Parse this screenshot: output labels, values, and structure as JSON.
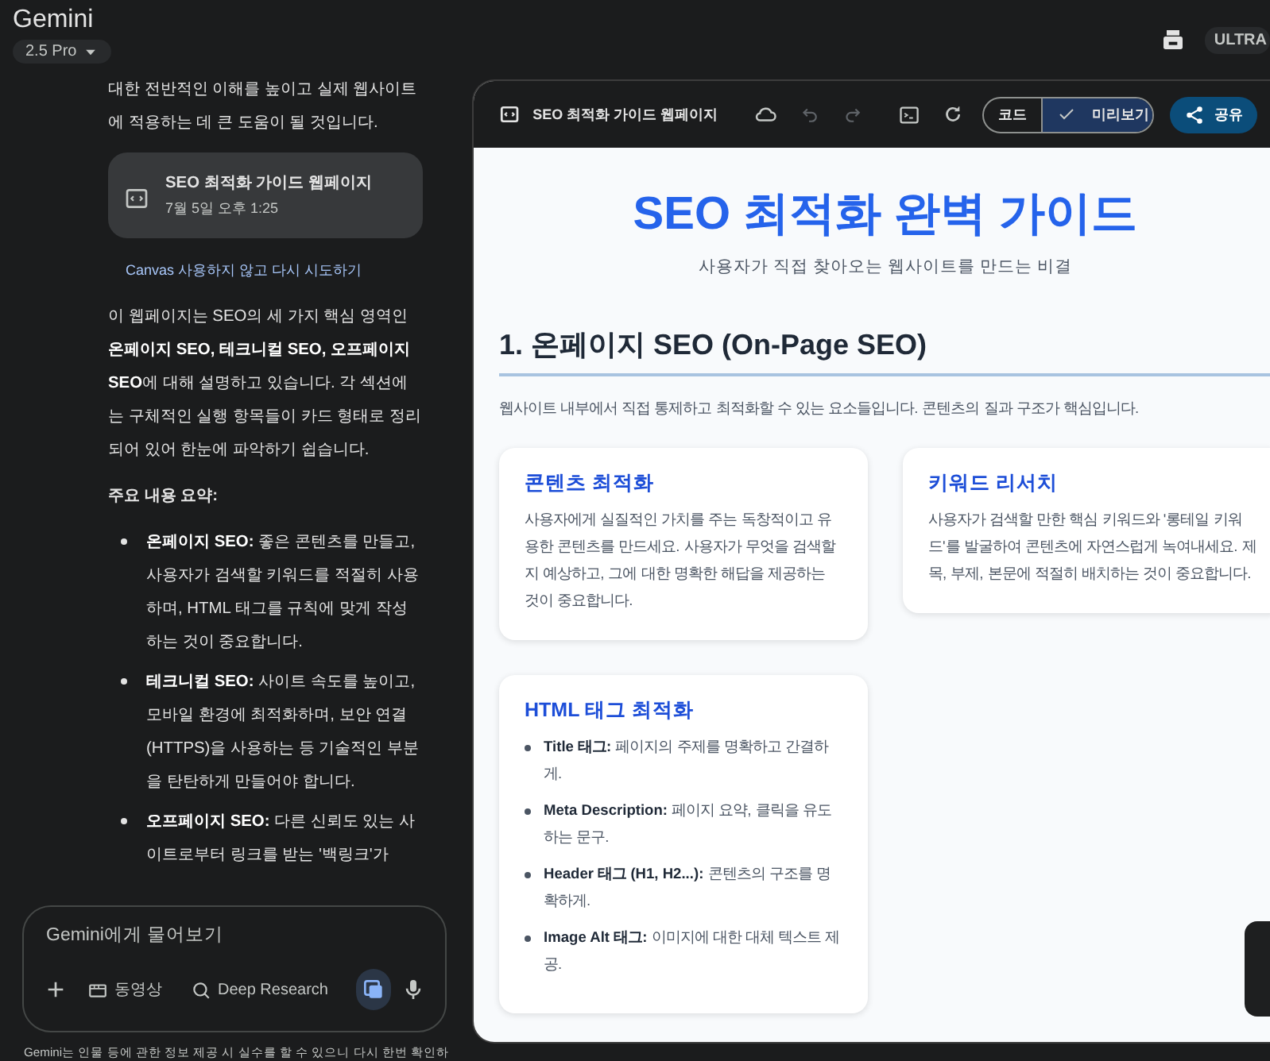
{
  "app": {
    "title": "Gemini",
    "model": "2.5 Pro",
    "plan": "ULTRA"
  },
  "chat": {
    "intro": "대한 전반적인 이해를 높이고 실제 웹사이트에 적용하는 데 큰 도움이 될 것입니다.",
    "artifact": {
      "title": "SEO 최적화 가이드 웹페이지",
      "time": "7월 5일 오후 1:25"
    },
    "retry_link": "Canvas 사용하지 않고 다시 시도하기",
    "summary": "이 웹페이지는 SEO의 세 가지 핵심 영역인 **온페이지 SEO, 테크니컬 SEO, 오프페이지 SEO**에 대해 설명하고 있습니다. 각 섹션에는 구체적인 실행 항목들이 카드 형태로 정리되어 있어 한눈에 파악하기 쉽습니다.",
    "summary_heading": "주요 내용 요약:",
    "bullets": [
      "**온페이지 SEO:** 좋은 콘텐츠를 만들고, 사용자가 검색할 키워드를 적절히 사용하며, HTML 태그를 규칙에 맞게 작성하는 것이 중요합니다.",
      "**테크니컬 SEO:** 사이트 속도를 높이고, 모바일 환경에 최적화하며, 보안 연결(HTTPS)을 사용하는 등 기술적인 부분을 탄탄하게 만들어야 합니다.",
      "**오프페이지 SEO:** 다른 신뢰도 있는 사이트로부터 링크를 받는 '백링크'가"
    ]
  },
  "composer": {
    "placeholder": "Gemini에게 물어보기",
    "tools": [
      {
        "kind": "video",
        "label": "동영상"
      },
      {
        "kind": "research",
        "label": "Deep Research"
      }
    ],
    "canvas_active": true
  },
  "disclaimer": "Gemini는 인물 등에 관한 정보 제공 시 실수를 할 수 있으니 다시 한번 확인하",
  "canvas": {
    "title": "SEO 최적화 가이드 웹페이지",
    "undo_enabled": false,
    "redo_enabled": false,
    "view_tabs": [
      {
        "label": "코드",
        "selected": false
      },
      {
        "label": "미리보기",
        "selected": true
      }
    ],
    "share": "공유",
    "page": {
      "title": "SEO 최적화 완벽 가이드",
      "subtitle": "사용자가 직접 찾아오는 웹사이트를 만드는 비결",
      "sections": [
        {
          "heading": "1. 온페이지 SEO (On-Page SEO)",
          "intro": "웹사이트 내부에서 직접 통제하고 최적화할 수 있는 요소들입니다. 콘텐츠의 질과 구조가 핵심입니다.",
          "cards": [
            {
              "kind": "text",
              "title": "콘텐츠 최적화",
              "body": "사용자에게 실질적인 가치를 주는 독창적이고 유용한 콘텐츠를 만드세요. 사용자가 무엇을 검색할지 예상하고, 그에 대한 명확한 해답을 제공하는 것이 중요합니다."
            },
            {
              "kind": "text",
              "title": "키워드 리서치",
              "body": "사용자가 검색할 만한 핵심 키워드와 '롱테일 키워드'를 발굴하여 콘텐츠에 자연스럽게 녹여내세요. 제목, 부제, 본문에 적절히 배치하는 것이 중요합니다."
            },
            {
              "kind": "list",
              "title": "HTML 태그 최적화",
              "items": [
                "**Title 태그:** 페이지의 주제를 명확하고 간결하게.",
                "**Meta Description:** 페이지 요약, 클릭을 유도하는 문구.",
                "**Header 태그 (H1, H2...):** 콘텐츠의 구조를 명확하게.",
                "**Image Alt 태그:** 이미지에 대한 대체 텍스트 제공."
              ]
            }
          ]
        }
      ]
    }
  }
}
